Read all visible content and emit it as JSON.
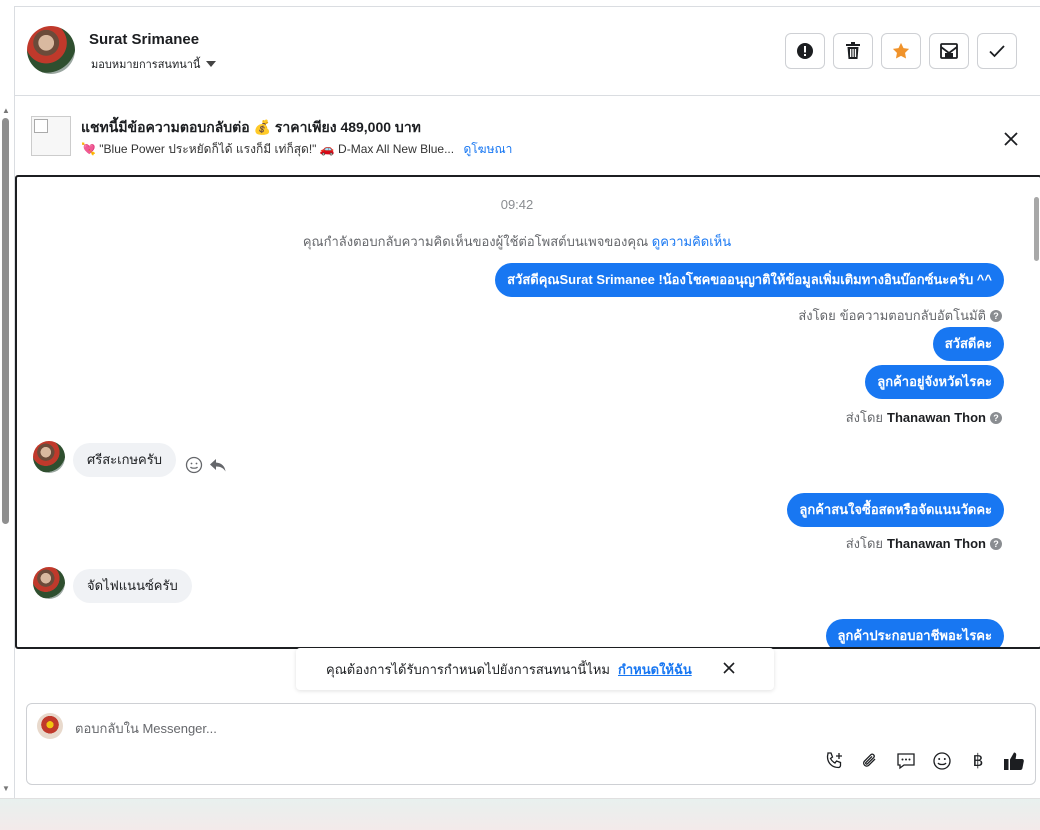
{
  "header": {
    "user_name": "Surat Srimanee",
    "assign_label": "มอบหมายการสนทนานี้",
    "actions": [
      "mark-spam",
      "delete",
      "star",
      "mark-unread",
      "done"
    ]
  },
  "ad": {
    "title": "แชทนี้มีข้อความตอบกลับต่อ 💰 ราคาเพียง 489,000 บาท",
    "subtitle": "💘 \"Blue Power ประหยัดก็ได้ แรงก็มี เท่ก็สุด!\" 🚗 D-Max All New Blue...",
    "link": "ดูโฆษณา"
  },
  "chat": {
    "time": "09:42",
    "system_note": "คุณกำลังตอบกลับความคิดเห็นของผู้ใช้ต่อโพสต์บนเพจของคุณ",
    "system_link": "ดูความคิดเห็น",
    "messages": {
      "m1": "สวัสดีคุณSurat Srimanee !น้องโชคขออนุญาติให้ข้อมูลเพิ่มเติมทางอินบ๊อกซ์นะครับ ^^",
      "m1_sent_prefix": "ส่งโดย",
      "m1_sent_by": "ข้อความตอบกลับอัตโนมัติ",
      "m2": "สวัสดีคะ",
      "m3": "ลูกค้าอยู่จังหวัดไรคะ",
      "m3_sent_prefix": "ส่งโดย",
      "m3_sent_by": "Thanawan Thon",
      "r1": "ศรีสะเกษครับ",
      "m4": "ลูกค้าสนใจซื้อสดหรือจัดแนนวัดคะ",
      "m4_sent_prefix": "ส่งโดย",
      "m4_sent_by": "Thanawan Thon",
      "r2": "จัดไฟแนนซ์ครับ",
      "m5": "ลูกค้าประกอบอาชีพอะไรคะ"
    }
  },
  "prompt": {
    "text": "คุณต้องการได้รับการกำหนดไปยังการสนทนานี้ไหม",
    "link": "กำหนดให้ฉัน"
  },
  "composer": {
    "placeholder": "ตอบกลับใน Messenger...",
    "icons": [
      "phone-add-icon",
      "attachment-icon",
      "saved-reply-icon",
      "emoji-icon",
      "baht-icon",
      "like-icon"
    ],
    "baht_symbol": "฿"
  }
}
